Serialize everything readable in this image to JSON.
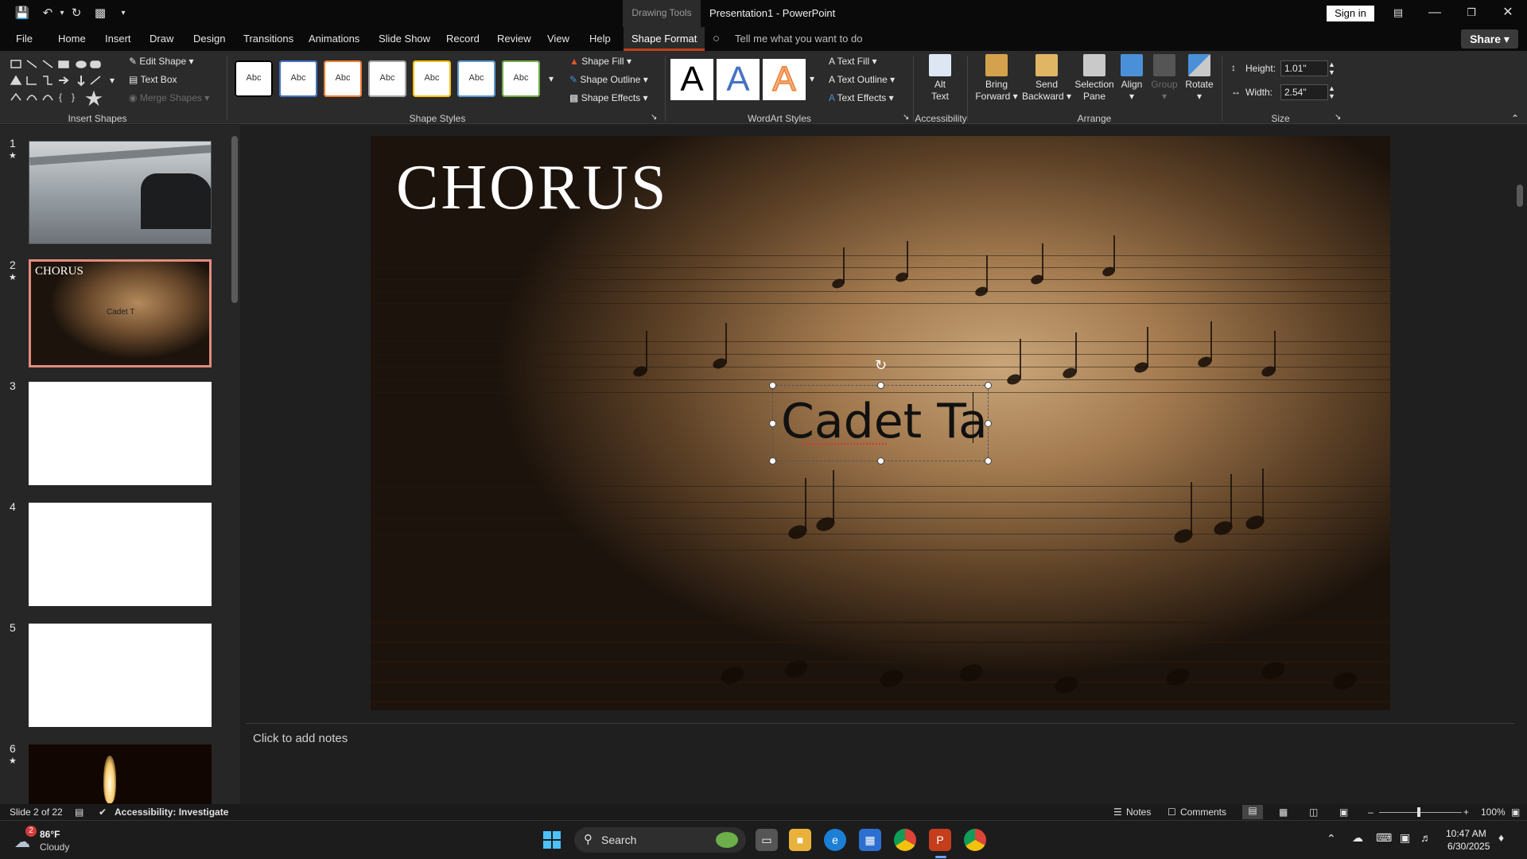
{
  "app": {
    "doc_title": "Presentation1  -  PowerPoint",
    "drawing_tools": "Drawing Tools",
    "sign_in": "Sign in",
    "share": "Share"
  },
  "tabs": [
    "File",
    "Home",
    "Insert",
    "Draw",
    "Design",
    "Transitions",
    "Animations",
    "Slide Show",
    "Record",
    "Review",
    "View",
    "Help",
    "Shape Format"
  ],
  "tell_me": "Tell me what you want to do",
  "ribbon": {
    "insert_shapes": {
      "label": "Insert Shapes",
      "edit_shape": "Edit Shape",
      "text_box": "Text Box",
      "merge_shapes": "Merge Shapes"
    },
    "shape_styles": {
      "label": "Shape Styles",
      "preset": "Abc",
      "preset_colors": [
        "#000000",
        "#4472c4",
        "#ed7d31",
        "#a5a5a5",
        "#ffc000",
        "#5b9bd5",
        "#70ad47"
      ],
      "shape_fill": "Shape Fill",
      "shape_outline": "Shape Outline",
      "shape_effects": "Shape Effects"
    },
    "wordart_styles": {
      "label": "WordArt Styles",
      "letter": "A",
      "text_fill": "Text Fill",
      "text_outline": "Text Outline",
      "text_effects": "Text Effects"
    },
    "accessibility": {
      "label": "Accessibility",
      "alt_text_1": "Alt",
      "alt_text_2": "Text"
    },
    "arrange": {
      "label": "Arrange",
      "bring_forward_1": "Bring",
      "bring_forward_2": "Forward",
      "send_backward_1": "Send",
      "send_backward_2": "Backward",
      "selection_pane_1": "Selection",
      "selection_pane_2": "Pane",
      "align": "Align",
      "group": "Group",
      "rotate": "Rotate"
    },
    "size": {
      "label": "Size",
      "height_label": "Height:",
      "height_value": "1.01\"",
      "width_label": "Width:",
      "width_value": "2.54\""
    }
  },
  "slides": [
    {
      "num": "1",
      "star": "★"
    },
    {
      "num": "2",
      "star": "★",
      "title": "CHORUS",
      "text": "Cadet T"
    },
    {
      "num": "3"
    },
    {
      "num": "4"
    },
    {
      "num": "5"
    },
    {
      "num": "6",
      "star": "★"
    }
  ],
  "slide": {
    "title": "CHORUS",
    "textbox": "Cadet Ta"
  },
  "notes_placeholder": "Click to add notes",
  "status": {
    "slide_count": "Slide 2 of 22",
    "accessibility": "Accessibility: Investigate",
    "notes": "Notes",
    "comments": "Comments",
    "zoom": "100%"
  },
  "taskbar": {
    "weather_temp": "86°F",
    "weather_desc": "Cloudy",
    "weather_badge": "2",
    "search": "Search",
    "time": "10:47 AM",
    "date": "6/30/2025"
  }
}
